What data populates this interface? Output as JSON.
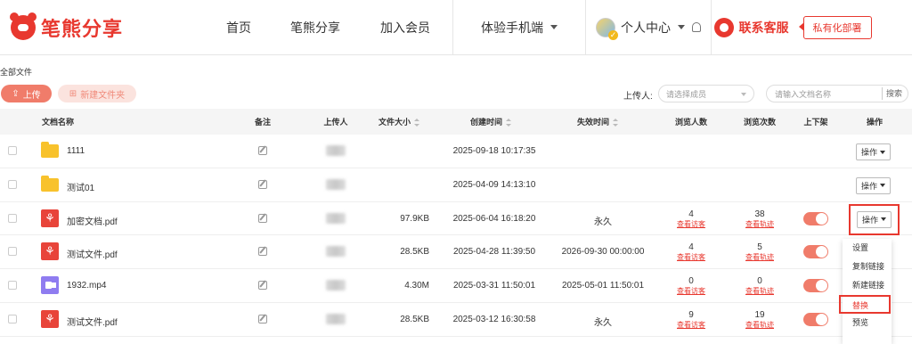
{
  "header": {
    "logo_text": "笔熊分享",
    "nav": [
      {
        "label": "首页"
      },
      {
        "label": "笔熊分享"
      },
      {
        "label": "加入会员"
      },
      {
        "label": "体验手机端"
      }
    ],
    "user_center": "个人中心",
    "service": "联系客服",
    "private_deploy": "私有化部署"
  },
  "breadcrumb": "全部文件",
  "toolbar": {
    "upload": "上传",
    "new_folder": "新建文件夹",
    "uploader_label": "上传人:",
    "uploader_placeholder": "请选择成员",
    "search_placeholder": "请输入文档名称",
    "search_btn": "搜索"
  },
  "table": {
    "columns": {
      "name": "文档名称",
      "note": "备注",
      "uploader": "上传人",
      "size": "文件大小",
      "created": "创建时间",
      "expire": "失效时间",
      "viewers": "浏览人数",
      "views": "浏览次数",
      "shelf": "上下架",
      "ops": "操作"
    },
    "rows": [
      {
        "type": "folder",
        "name": "1111",
        "size": "",
        "created": "2025-09-18 10:17:35",
        "expire": "",
        "viewers": "",
        "views": "",
        "toggle": false
      },
      {
        "type": "folder",
        "name": "测试01",
        "size": "",
        "created": "2025-04-09 14:13:10",
        "expire": "",
        "viewers": "",
        "views": "",
        "toggle": false
      },
      {
        "type": "pdf",
        "name": "加密文档.pdf",
        "size": "97.9KB",
        "created": "2025-06-04 16:18:20",
        "expire": "永久",
        "viewers": "4",
        "views": "38",
        "toggle": true
      },
      {
        "type": "pdf",
        "name": "测试文件.pdf",
        "size": "28.5KB",
        "created": "2025-04-28 11:39:50",
        "expire": "2026-09-30 00:00:00",
        "viewers": "4",
        "views": "5",
        "toggle": true
      },
      {
        "type": "video",
        "name": "1932.mp4",
        "size": "4.30M",
        "created": "2025-03-31 11:50:01",
        "expire": "2025-05-01 11:50:01",
        "viewers": "0",
        "views": "0",
        "toggle": true
      },
      {
        "type": "pdf",
        "name": "测试文件.pdf",
        "size": "28.5KB",
        "created": "2025-03-12 16:30:58",
        "expire": "永久",
        "viewers": "9",
        "views": "19",
        "toggle": true
      }
    ],
    "viewers_link": "查看访客",
    "views_link": "查看轨迹",
    "op_label": "操作"
  },
  "dropdown": {
    "items": [
      "设置",
      "复制链接",
      "新建链接",
      "替换",
      "预览"
    ],
    "active": "替换"
  },
  "colors": {
    "accent": "#e8382f",
    "toggle_on": "#f07c6a"
  }
}
